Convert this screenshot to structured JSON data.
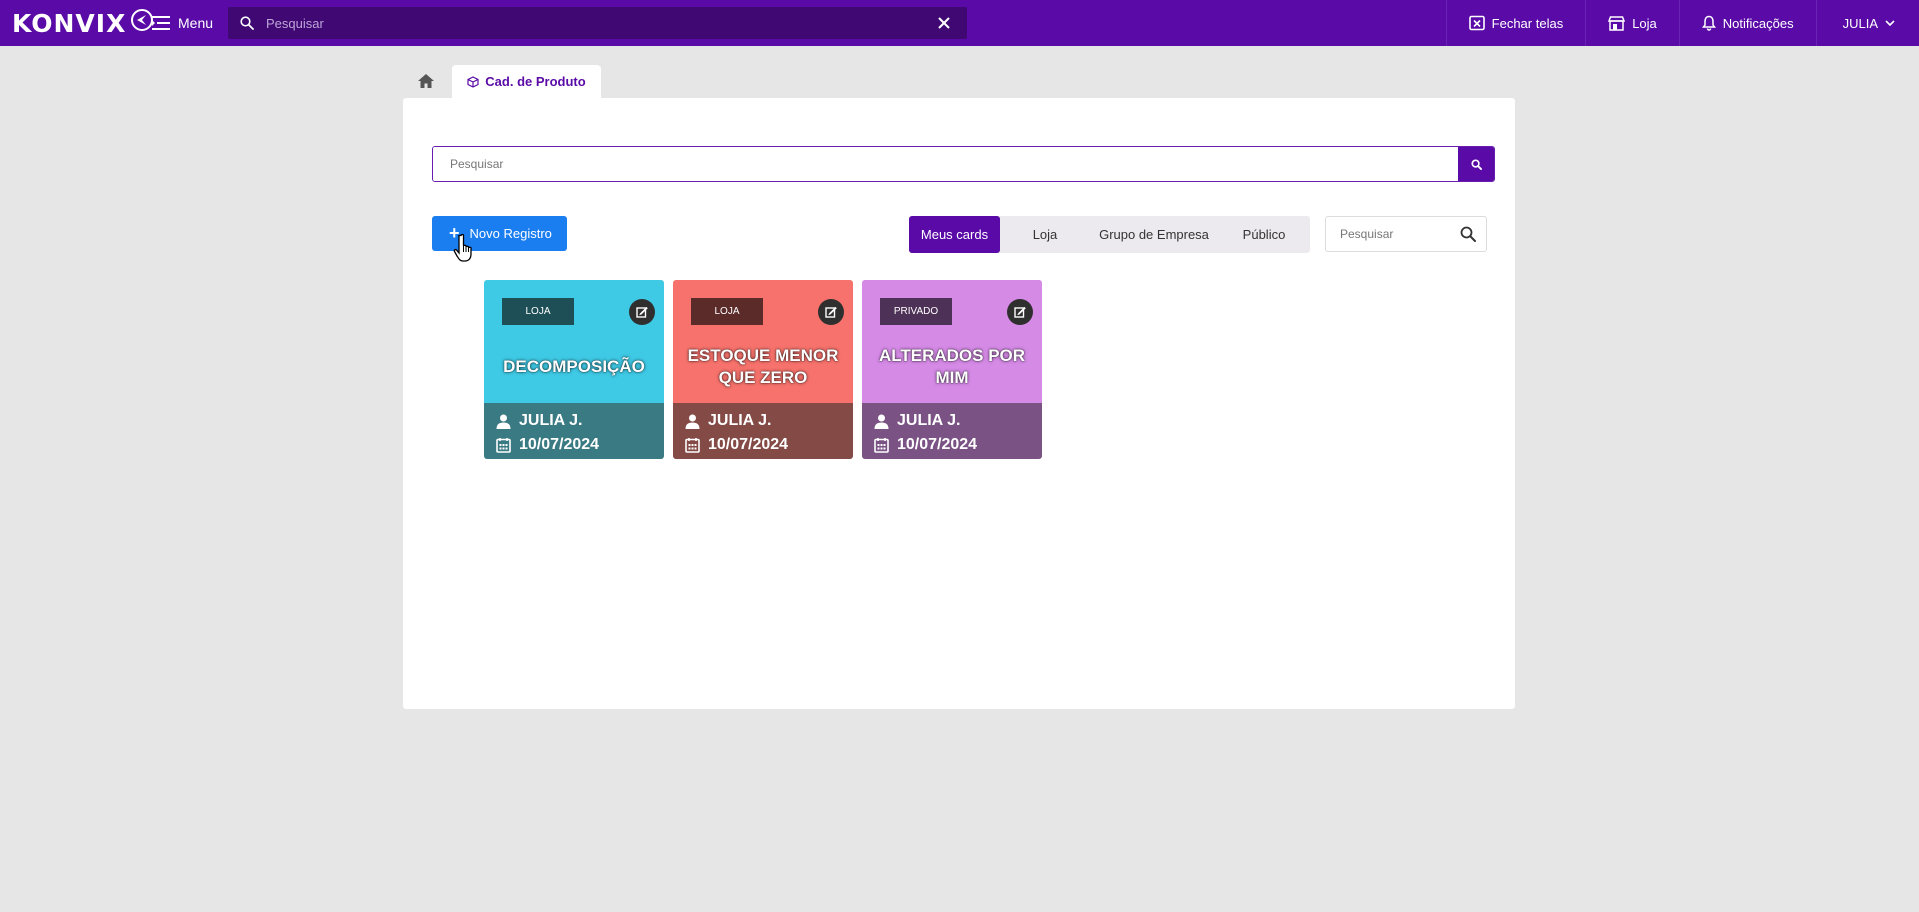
{
  "app": {
    "logo_text": "KONVIX"
  },
  "topbar": {
    "menu_label": "Menu",
    "search_placeholder": "Pesquisar",
    "close_screens_label": "Fechar telas",
    "store_label": "Loja",
    "notifications_label": "Notificações",
    "user_label": "JULIA"
  },
  "tabs": {
    "active_label": "Cad. de Produto"
  },
  "panel": {
    "search_placeholder": "Pesquisar",
    "new_button_label": "Novo Registro",
    "filters": [
      "Meus cards",
      "Loja",
      "Grupo de Empresa",
      "Público"
    ],
    "active_filter": "Meus cards",
    "card_search_placeholder": "Pesquisar"
  },
  "cards": [
    {
      "badge": "LOJA",
      "title": "DECOMPOSIÇÃO",
      "user": "JULIA J.",
      "date": "10/07/2024",
      "color_top": "#3ec9e5",
      "color_bottom": "#3a7a82",
      "color_badge": "#1e4f56"
    },
    {
      "badge": "LOJA",
      "title": "ESTOQUE MENOR QUE ZERO",
      "user": "JULIA J.",
      "date": "10/07/2024",
      "color_top": "#f7726c",
      "color_bottom": "#844a46",
      "color_badge": "#5b2b29"
    },
    {
      "badge": "PRIVADO",
      "title": "ALTERADOS POR MIM",
      "user": "JULIA J.",
      "date": "10/07/2024",
      "color_top": "#d58ae6",
      "color_bottom": "#7a5284",
      "color_badge": "#4e3157"
    }
  ],
  "colors": {
    "primary": "#5a0aa6",
    "topbar_search": "#3f0873",
    "new_button": "#1a7ef0"
  }
}
